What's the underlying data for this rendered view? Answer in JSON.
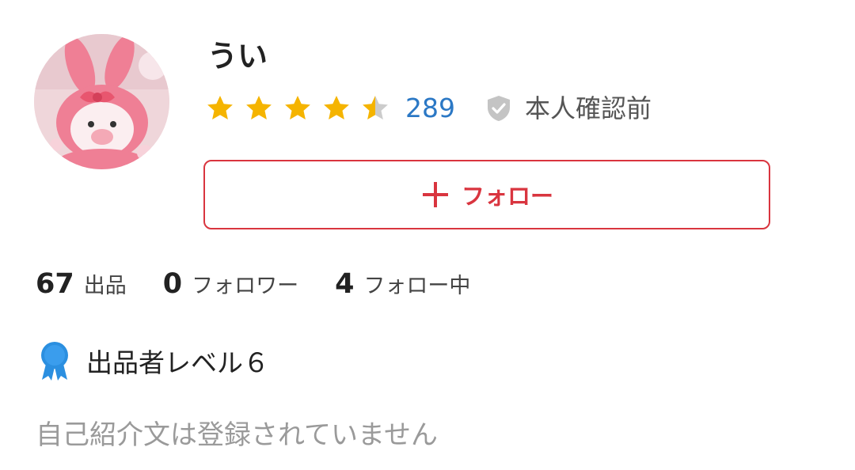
{
  "profile": {
    "name": "うい",
    "avatar_alt": "avatar",
    "rating": {
      "stars": 4.5,
      "max": 5,
      "count": "289"
    },
    "verification": {
      "label": "本人確認前",
      "icon": "shield-check-icon"
    },
    "follow_button": {
      "label": "フォロー",
      "icon": "plus-icon"
    },
    "stats": [
      {
        "value": "67",
        "label": "出品"
      },
      {
        "value": "0",
        "label": "フォロワー"
      },
      {
        "value": "4",
        "label": "フォロー中"
      }
    ],
    "level": {
      "label": "出品者レベル６",
      "icon": "ribbon-badge-icon"
    },
    "bio": "自己紹介文は登録されていません"
  },
  "colors": {
    "accent": "#d9353f",
    "star": "#f5b400",
    "star_empty": "#cccccc",
    "link": "#2b78c5",
    "badge": "#2b8fe0",
    "muted": "#9a9a9a"
  }
}
